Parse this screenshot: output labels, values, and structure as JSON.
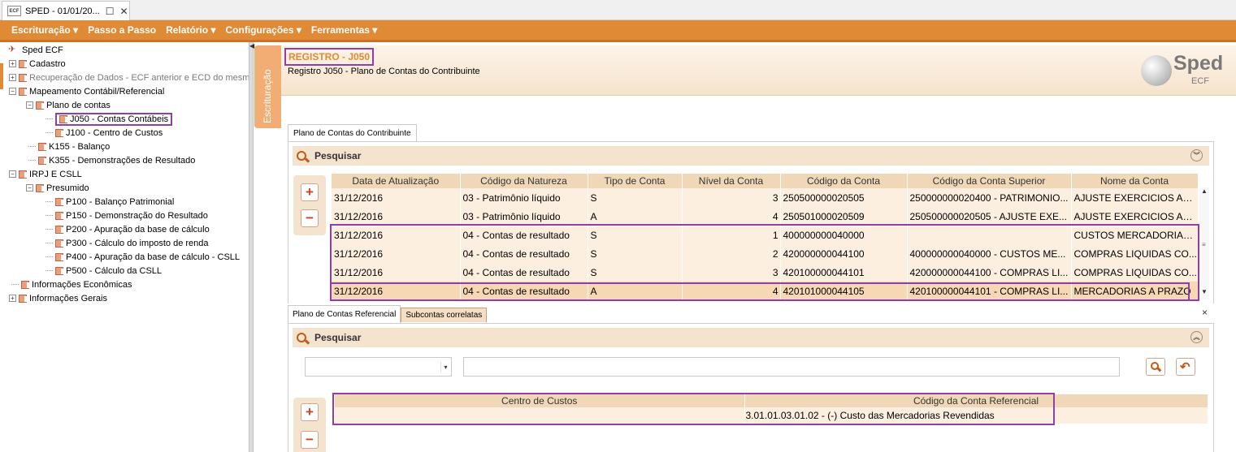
{
  "window": {
    "icon_text": "ECF",
    "title": "SPED - 01/01/20...",
    "maximize_glyph": "☐",
    "close_glyph": "✕"
  },
  "menu": [
    {
      "label": "Escrituração ▾"
    },
    {
      "label": "Passo a Passo"
    },
    {
      "label": "Relatório ▾"
    },
    {
      "label": "Configurações ▾"
    },
    {
      "label": "Ferramentas ▾"
    }
  ],
  "tree": {
    "root": "Sped ECF",
    "items": [
      {
        "label": "Cadastro"
      },
      {
        "label": "Recuperação de Dados - ECF anterior e ECD do mesmo"
      },
      {
        "label": "Mapeamento Contábil/Referencial"
      },
      {
        "label": "Plano de contas"
      },
      {
        "label": "J050 - Contas Contábeis"
      },
      {
        "label": "J100 - Centro de Custos"
      },
      {
        "label": "K155 - Balanço"
      },
      {
        "label": "K355 - Demonstrações de Resultado"
      },
      {
        "label": "IRPJ E CSLL"
      },
      {
        "label": "Presumido"
      },
      {
        "label": "P100 - Balanço Patrimonial"
      },
      {
        "label": "P150 - Demonstração do Resultado"
      },
      {
        "label": "P200 - Apuração da base de cálculo"
      },
      {
        "label": "P300 - Cálculo do imposto de renda"
      },
      {
        "label": "P400 - Apuração da base de cálculo - CSLL"
      },
      {
        "label": "P500 - Cálculo da CSLL"
      },
      {
        "label": "Informações Econômicas"
      },
      {
        "label": "Informações Gerais"
      }
    ]
  },
  "side_tab": {
    "label": "Escrituração"
  },
  "header": {
    "title": "REGISTRO - J050",
    "subtitle": "Registro J050 - Plano de Contas do Contribuinte"
  },
  "logo": {
    "text": "Sped",
    "sub": "ECF"
  },
  "upper": {
    "tab_label": "Plano de Contas do Contribuinte",
    "search_label": "Pesquisar",
    "collapse_glyph": "︾",
    "add_glyph": "+",
    "remove_glyph": "−",
    "columns": [
      "Data de Atualização",
      "Código da Natureza",
      "Tipo de Conta",
      "Nível da Conta",
      "Código da Conta",
      "Código da Conta Superior",
      "Nome da Conta"
    ],
    "rows": [
      [
        "31/12/2016",
        "03 - Patrimônio líquido",
        "S",
        "3",
        "250500000020505",
        "250000000020400 - PATRIMONIO...",
        "AJUSTE EXERCICIOS AN..."
      ],
      [
        "31/12/2016",
        "03 - Patrimônio líquido",
        "A",
        "4",
        "250501000020509",
        "250500000020505 - AJUSTE EXE...",
        "AJUSTE EXERCICIOS AN..."
      ],
      [
        "31/12/2016",
        "04 - Contas de resultado",
        "S",
        "1",
        "400000000040000",
        "",
        "CUSTOS MERCADORIAS/..."
      ],
      [
        "31/12/2016",
        "04 - Contas de resultado",
        "S",
        "2",
        "420000000044100",
        "400000000040000 - CUSTOS ME...",
        "COMPRAS LIQUIDAS CO..."
      ],
      [
        "31/12/2016",
        "04 - Contas de resultado",
        "S",
        "3",
        "420100000044101",
        "420000000044100 - COMPRAS LI...",
        "COMPRAS LIQUIDAS CO..."
      ],
      [
        "31/12/2016",
        "04 - Contas de resultado",
        "A",
        "4",
        "420101000044105",
        "420100000044101 - COMPRAS LI...",
        "MERCADORIAS A PRAZO"
      ]
    ],
    "scroll_up": "▲",
    "scroll_down": "▼",
    "scroll_thumb": "≡"
  },
  "lower": {
    "tabs": [
      {
        "label": "Plano de Contas Referencial"
      },
      {
        "label": "Subcontas correlatas"
      }
    ],
    "close_glyph": "×",
    "search_label": "Pesquisar",
    "collapse_glyph": "︽",
    "combo_value": "",
    "combo_arrow": "▾",
    "search_input_value": "",
    "undo_glyph": "↶",
    "add_glyph": "+",
    "remove_glyph": "−",
    "columns": [
      "Centro de Custos",
      "Código da Conta Referencial"
    ],
    "rows": [
      [
        "",
        "3.01.01.03.01.02 - (-) Custo das Mercadorias Revendidas"
      ]
    ]
  }
}
